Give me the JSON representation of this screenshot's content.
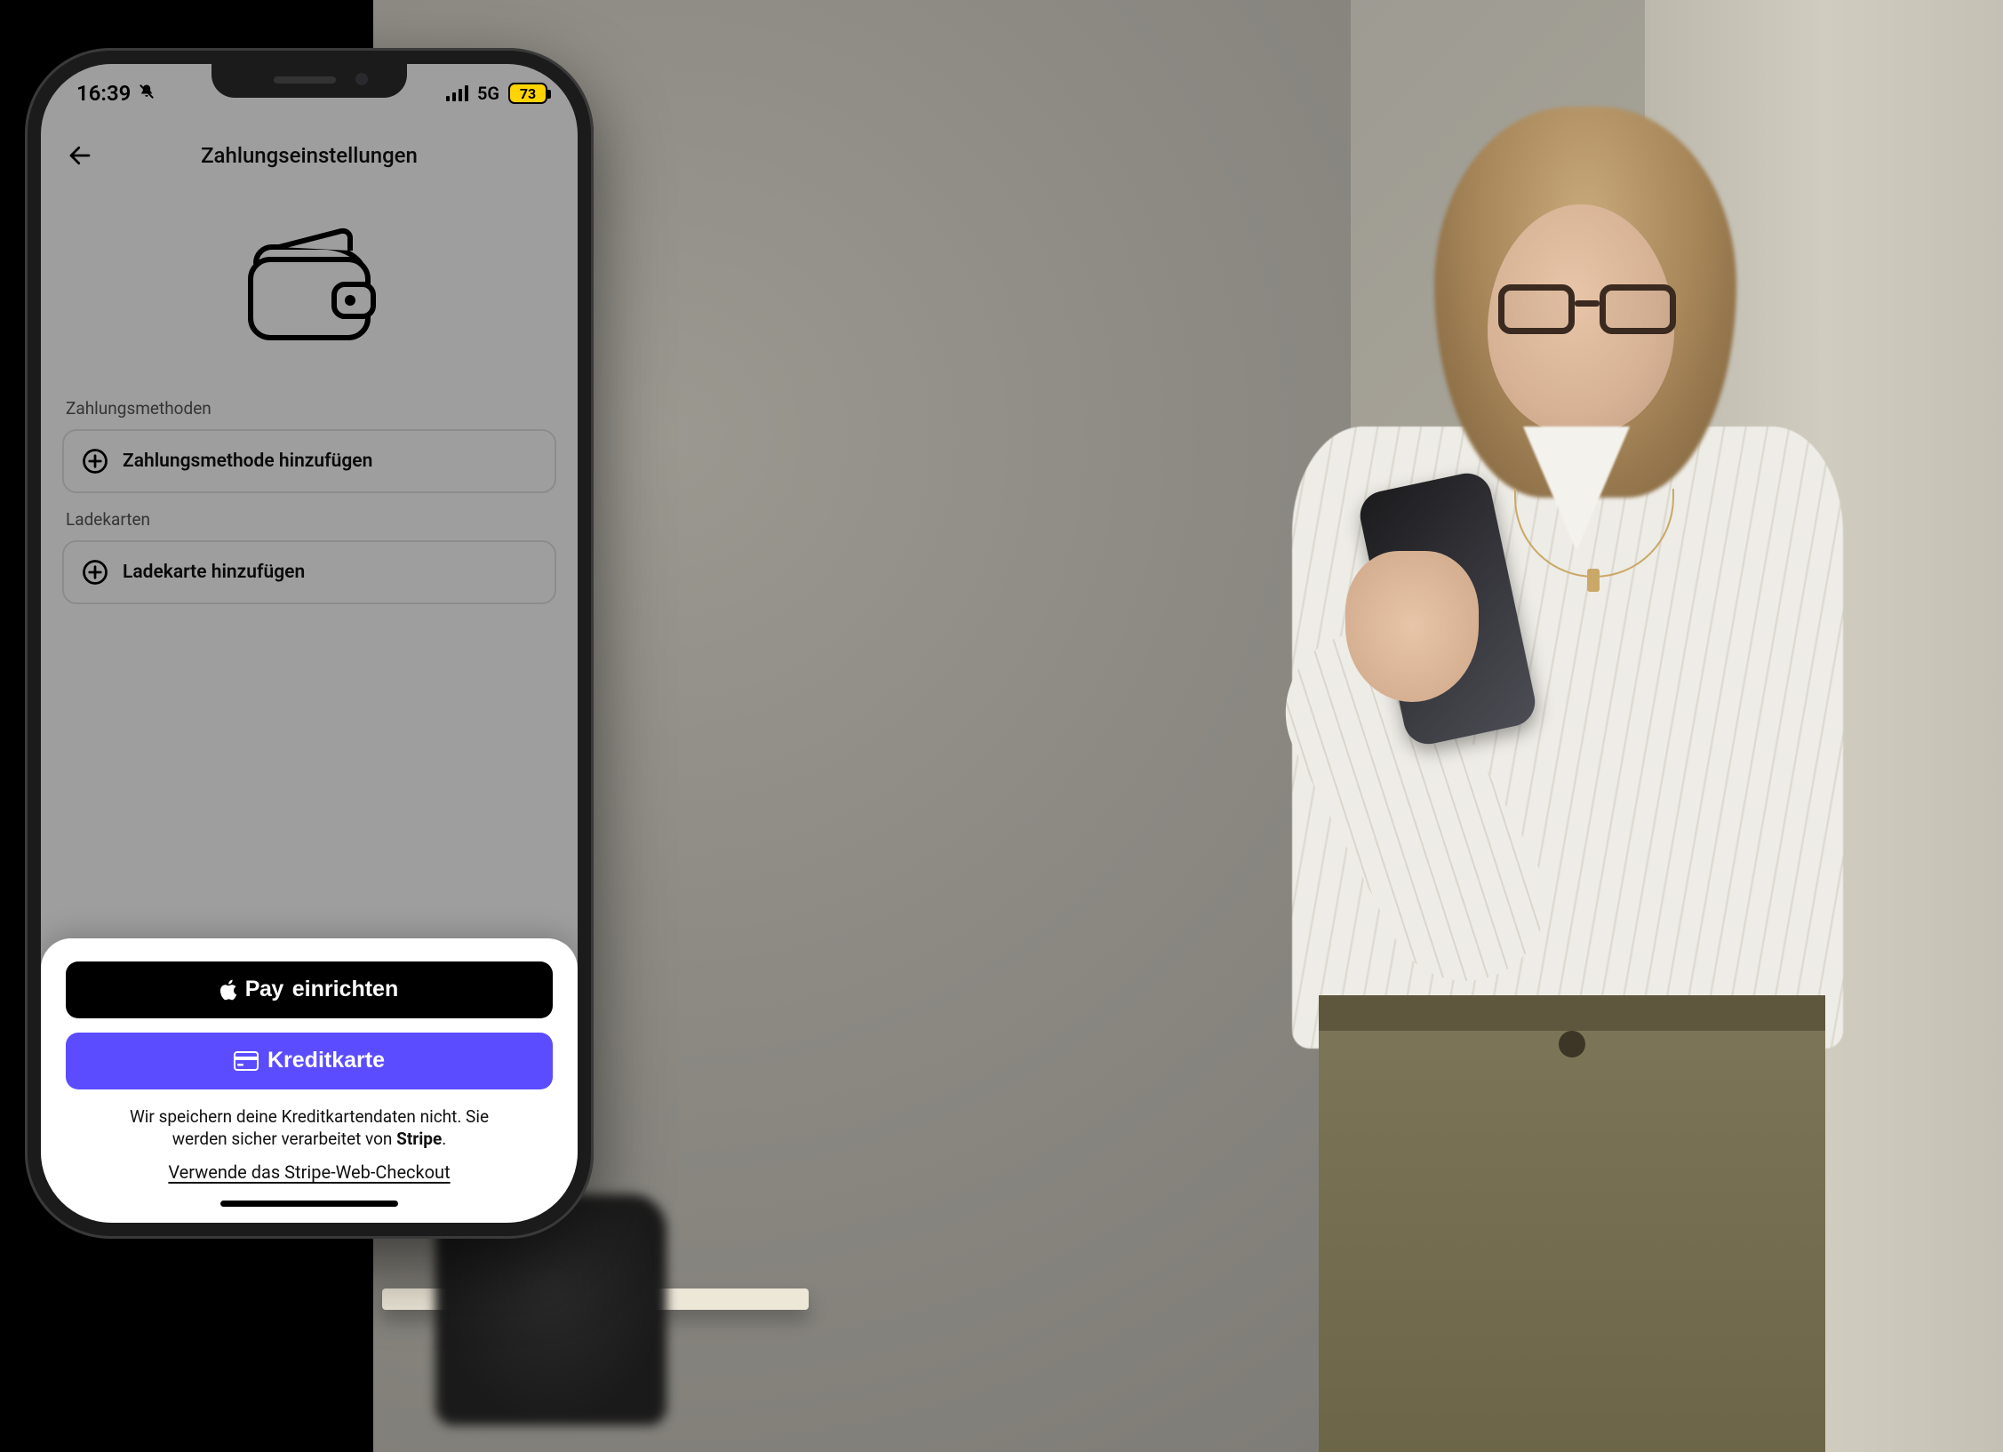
{
  "status": {
    "time": "16:39",
    "network": "5G",
    "battery": "73"
  },
  "header": {
    "title": "Zahlungseinstellungen"
  },
  "sections": {
    "payment_methods_label": "Zahlungsmethoden",
    "add_payment_method": "Zahlungsmethode hinzufügen",
    "charge_cards_label": "Ladekarten",
    "add_charge_card": "Ladekarte hinzufügen"
  },
  "sheet": {
    "apple_pay_word": "Pay",
    "apple_pay_setup": "einrichten",
    "credit_card": "Kreditkarte",
    "note_line1": "Wir speichern deine Kreditkartendaten nicht. Sie",
    "note_line2a": "werden sicher verarbeitet von ",
    "note_stripe": "Stripe",
    "note_line2b": ".",
    "link": "Verwende das Stripe-Web-Checkout"
  }
}
